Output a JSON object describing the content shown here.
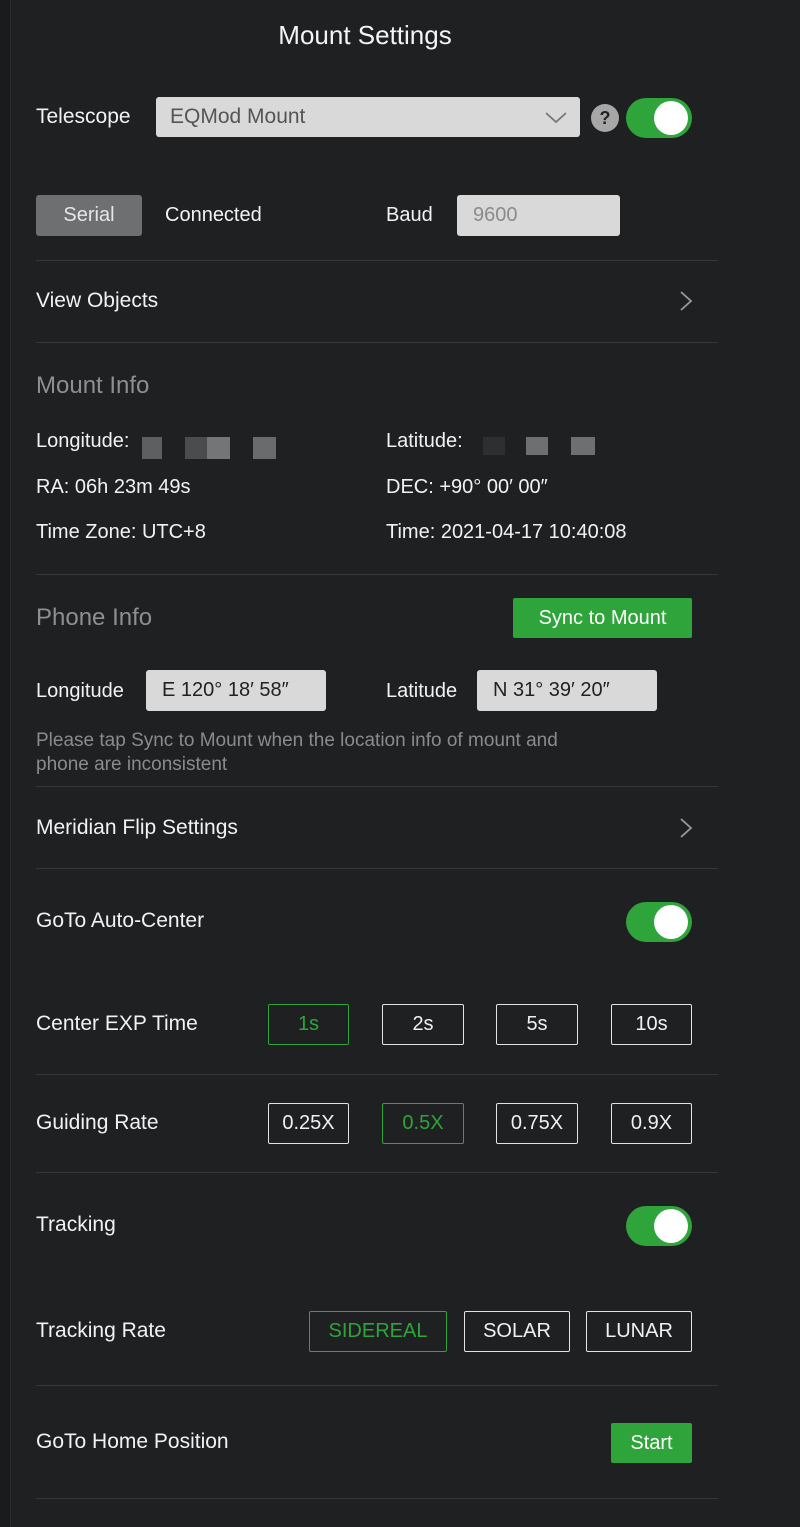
{
  "header": {
    "title": "Mount Settings"
  },
  "telescope": {
    "label": "Telescope",
    "selected": "EQMod Mount",
    "help": "?",
    "enabled": true
  },
  "connection": {
    "type_label": "Serial",
    "status": "Connected",
    "baud_label": "Baud",
    "baud_value": "9600"
  },
  "view_objects": {
    "label": "View Objects"
  },
  "mount_info": {
    "title": "Mount Info",
    "longitude_label": "Longitude:",
    "latitude_label": "Latitude:",
    "ra": "RA: 06h 23m 49s",
    "dec": "DEC: +90° 00′ 00″",
    "timezone": "Time Zone: UTC+8",
    "time": "Time: 2021-04-17 10:40:08"
  },
  "phone_info": {
    "title": "Phone Info",
    "sync_button": "Sync to Mount",
    "longitude_label": "Longitude",
    "longitude_value": "E 120° 18′ 58″",
    "latitude_label": "Latitude",
    "latitude_value": "N 31° 39′ 20″",
    "note_line1": "Please tap Sync to Mount when the location info of mount and",
    "note_line2": "phone are inconsistent"
  },
  "meridian": {
    "label": "Meridian Flip Settings"
  },
  "goto_center": {
    "label": "GoTo Auto-Center",
    "enabled": true
  },
  "center_exp": {
    "label": "Center EXP Time",
    "options": [
      "1s",
      "2s",
      "5s",
      "10s"
    ],
    "selected": "1s"
  },
  "guiding": {
    "label": "Guiding Rate",
    "options": [
      "0.25X",
      "0.5X",
      "0.75X",
      "0.9X"
    ],
    "selected": "0.5X"
  },
  "tracking": {
    "label": "Tracking",
    "enabled": true
  },
  "tracking_rate": {
    "label": "Tracking Rate",
    "options": [
      "SIDEREAL",
      "SOLAR",
      "LUNAR"
    ],
    "selected": "SIDEREAL"
  },
  "goto_home": {
    "label": "GoTo Home Position",
    "button": "Start"
  },
  "colors": {
    "accent": "#2fa43a",
    "background": "#1f2021"
  }
}
